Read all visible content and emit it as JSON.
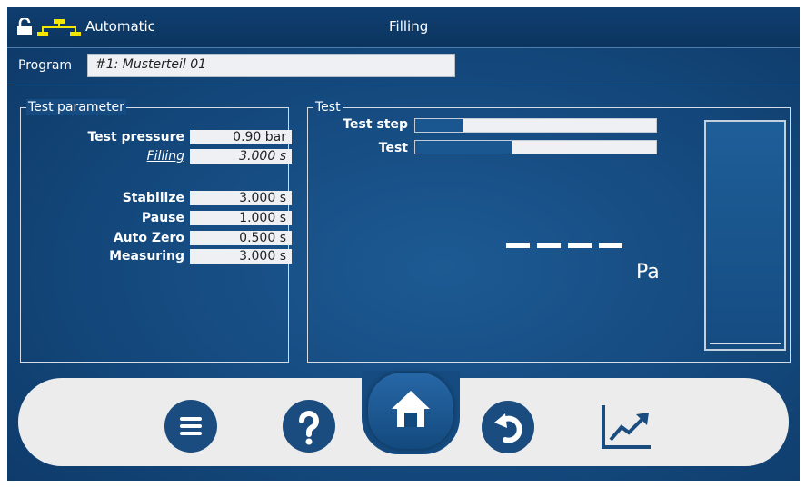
{
  "header": {
    "mode": "Automatic",
    "title": "Filling",
    "lock_icon": "padlock-open-icon",
    "network_icon": "network-icon",
    "network_color": "#f3e600"
  },
  "program": {
    "label": "Program",
    "value": "#1: Musterteil 01"
  },
  "test_parameter": {
    "title": "Test parameter",
    "rows": [
      {
        "label": "Test pressure",
        "value": "0.90 bar"
      },
      {
        "label": "Filling",
        "value": "3.000 s"
      },
      {
        "label": "Stabilize",
        "value": "3.000 s"
      },
      {
        "label": "Pause",
        "value": "1.000 s"
      },
      {
        "label": "Auto Zero",
        "value": "0.500 s"
      },
      {
        "label": "Measuring",
        "value": "3.000 s"
      }
    ]
  },
  "test": {
    "title": "Test",
    "test_step_label": "Test step",
    "test_step_progress": 0.2,
    "test_label": "Test",
    "test_progress": 0.4,
    "reading": "----",
    "unit": "Pa"
  },
  "bottom_nav": {
    "menu_icon": "menu-icon",
    "help_icon": "help-icon",
    "home_icon": "home-icon",
    "back_icon": "undo-icon",
    "chart_icon": "trend-chart-icon"
  },
  "colors": {
    "background": "#154b80",
    "bottom_bar": "#ececec",
    "button": "#1a4c80"
  }
}
